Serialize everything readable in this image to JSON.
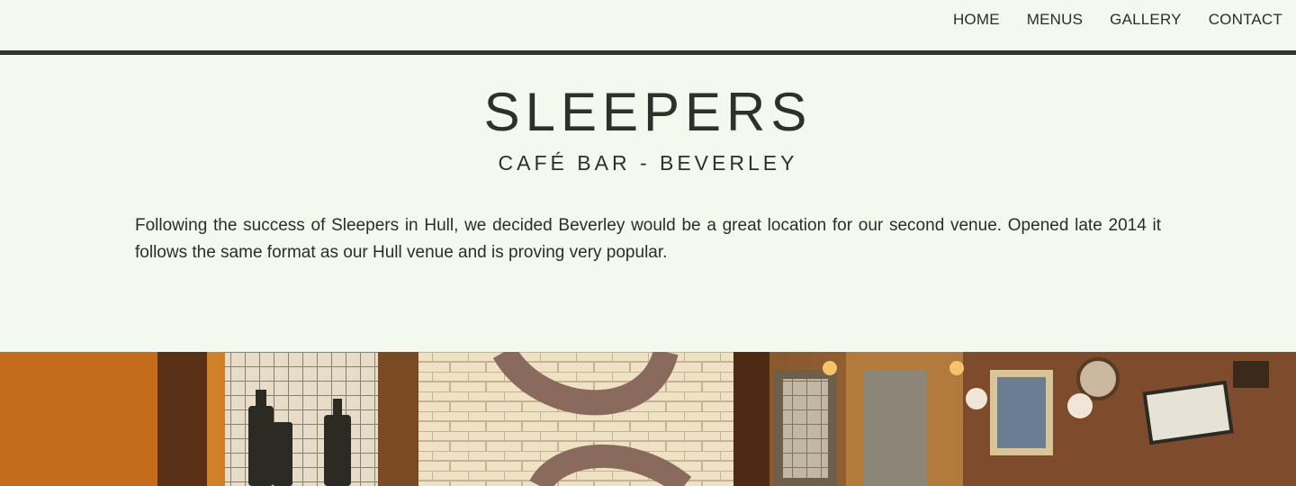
{
  "nav": {
    "items": [
      "HOME",
      "MENUS",
      "GALLERY",
      "CONTACT"
    ]
  },
  "brand": {
    "title": "SLEEPERS",
    "subtitle": "CAFÉ BAR - BEVERLEY"
  },
  "intro": {
    "text": "Following the success of Sleepers in Hull, we decided Beverley would be a great location for our second venue. Opened late 2014 it follows the same format as our Hull venue and is proving very popular."
  },
  "colors": {
    "background": "#f4f9ef",
    "text": "#2f302c",
    "rule": "#33342f"
  },
  "hero": {
    "icon": "cafe-interior-photo"
  }
}
